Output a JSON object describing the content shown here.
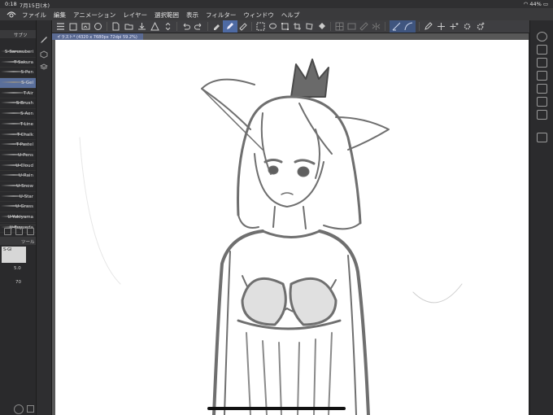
{
  "status_bar": {
    "time": "0:18",
    "date": "7月15日(木)",
    "battery": "44%"
  },
  "menu_bar": {
    "items": [
      "ファイル",
      "編集",
      "アニメーション",
      "レイヤー",
      "選択範囲",
      "表示",
      "フィルター",
      "ウィンドウ",
      "ヘルプ"
    ]
  },
  "left_panel": {
    "header_label": "サブツ",
    "brushes": [
      {
        "label": "S-Sarusuberi"
      },
      {
        "label": "T-Sakura"
      },
      {
        "label": "S-Pen"
      },
      {
        "label": "S-Gel"
      },
      {
        "label": "T-Air"
      },
      {
        "label": "S-Brush"
      },
      {
        "label": "S-Aen"
      },
      {
        "label": "T-Line"
      },
      {
        "label": "T-Chalk"
      },
      {
        "label": "T-Pastel"
      },
      {
        "label": "U-Pens"
      },
      {
        "label": "U-Cloud"
      },
      {
        "label": "U-Rain"
      },
      {
        "label": "U-Snow"
      },
      {
        "label": "U-Star"
      },
      {
        "label": "U-Grass"
      },
      {
        "label": "U-Yukiyama"
      },
      {
        "label": "U-Fuyueda"
      }
    ],
    "selected_brush": "S-Gel",
    "tool_header_label": "ツール",
    "tool_sub_label": "S-Gl",
    "size_value": "5.0",
    "opacity_value": "70"
  },
  "canvas": {
    "tab_label": "イラスト* (4320 x 7680px 72dpi 59.2%)"
  },
  "colors": {
    "accent": "#4e6aa3",
    "selected_brush_bg": "#5a6f9b",
    "panel_bg": "#2a2a2c",
    "paper": "#ffffff"
  }
}
